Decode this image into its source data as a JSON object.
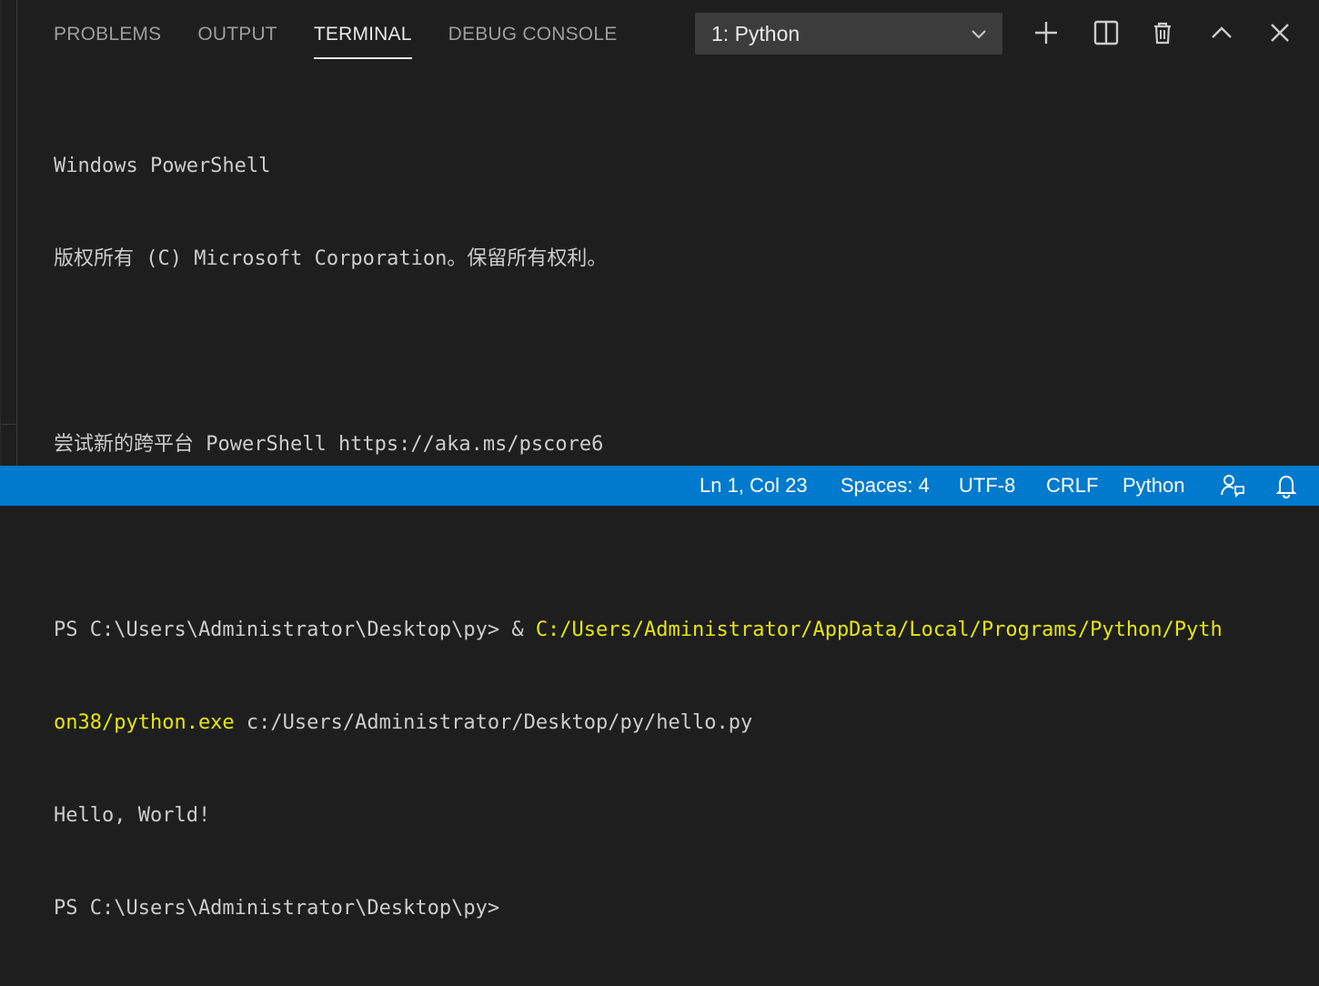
{
  "panel": {
    "tabs": [
      {
        "label": "PROBLEMS"
      },
      {
        "label": "OUTPUT"
      },
      {
        "label": "TERMINAL"
      },
      {
        "label": "DEBUG CONSOLE"
      }
    ],
    "active_tab": "TERMINAL",
    "terminal_select": {
      "value": "1: Python"
    },
    "toolbar_icons": [
      "plus-icon",
      "split-icon",
      "trash-icon",
      "chevron-up-icon",
      "close-icon"
    ]
  },
  "terminal": {
    "line1": "Windows PowerShell",
    "line2": "版权所有 (C) Microsoft Corporation。保留所有权利。",
    "line3": "尝试新的跨平台 PowerShell https://aka.ms/pscore6",
    "cmd_prompt": "PS C:\\Users\\Administrator\\Desktop\\py> & ",
    "cmd_exe_part1": "C:/Users/Administrator/AppData/Local/Programs/Python/Pyth",
    "cmd_exe_part2": "on38/python.exe",
    "cmd_arg": " c:/Users/Administrator/Desktop/py/hello.py",
    "output": "Hello, World!",
    "prompt": "PS C:\\Users\\Administrator\\Desktop\\py>"
  },
  "statusbar": {
    "position": "Ln 1, Col 23",
    "spaces": "Spaces: 4",
    "encoding": "UTF-8",
    "eol": "CRLF",
    "language": "Python",
    "icons": [
      "feedback-icon",
      "bell-icon"
    ]
  },
  "colors": {
    "background": "#1e1e1e",
    "statusbar": "#007acc",
    "exe_path": "#e5e510",
    "text": "#cccccc"
  }
}
